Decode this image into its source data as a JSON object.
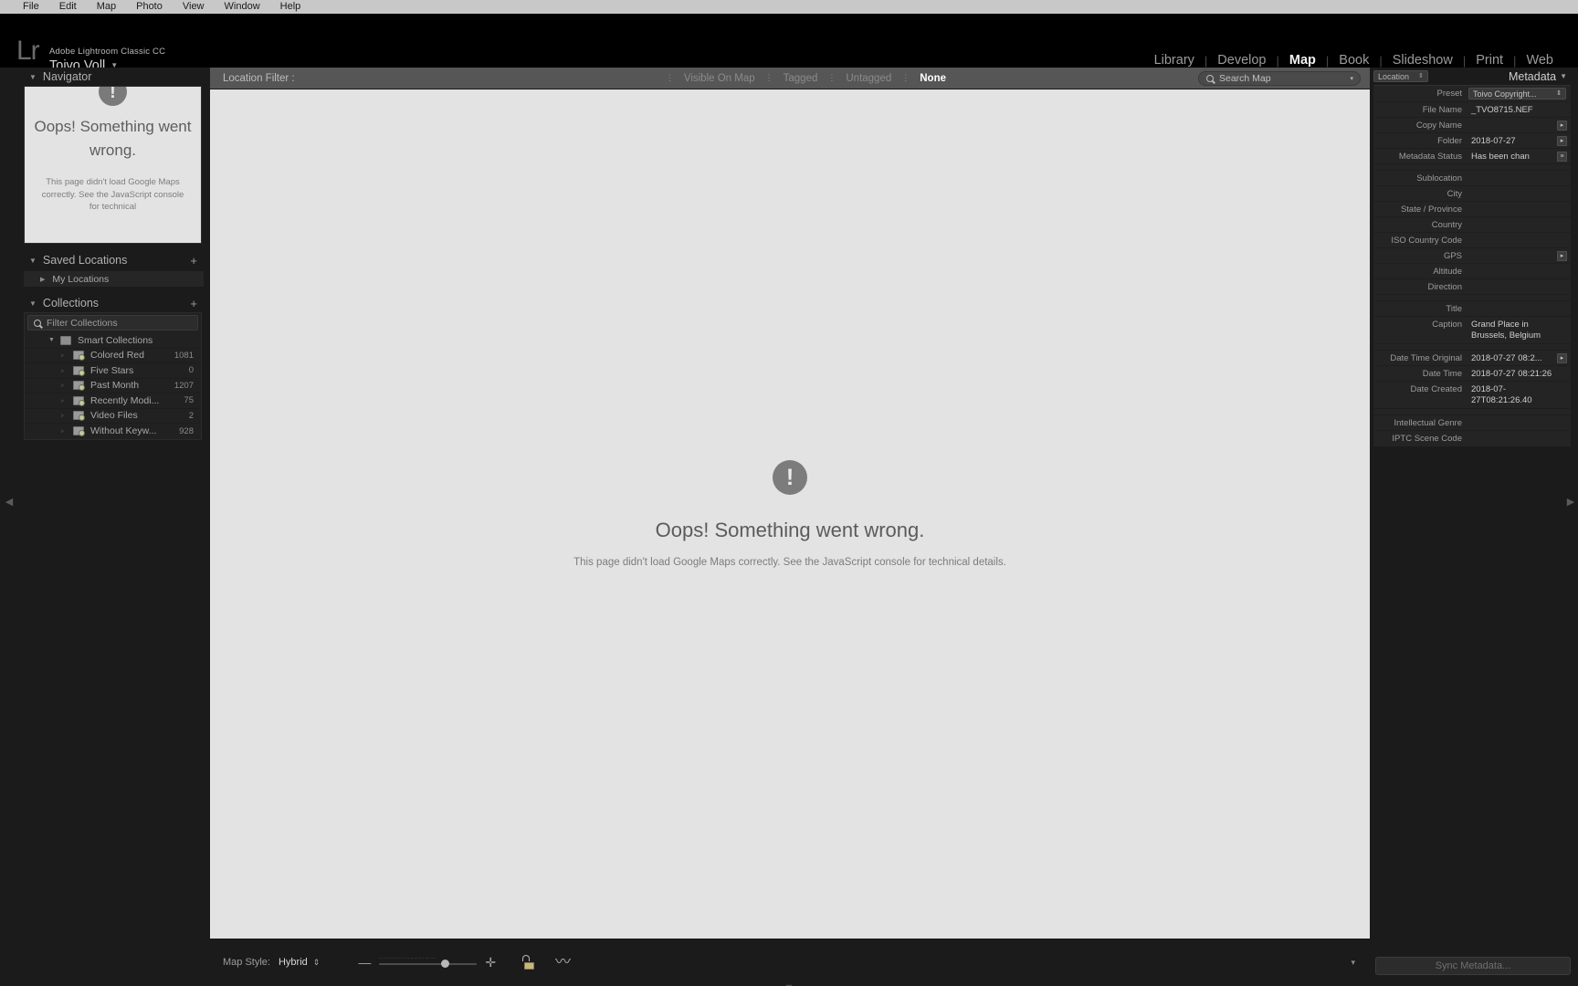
{
  "menubar": {
    "items": [
      "File",
      "Edit",
      "Map",
      "Photo",
      "View",
      "Window",
      "Help"
    ]
  },
  "identity": {
    "logo": "Lr",
    "app_name": "Adobe Lightroom Classic CC",
    "user_name": "Toivo Voll",
    "caret": "▼"
  },
  "modules": {
    "items": [
      {
        "label": "Library",
        "active": false
      },
      {
        "label": "Develop",
        "active": false
      },
      {
        "label": "Map",
        "active": true
      },
      {
        "label": "Book",
        "active": false
      },
      {
        "label": "Slideshow",
        "active": false
      },
      {
        "label": "Print",
        "active": false
      },
      {
        "label": "Web",
        "active": false
      }
    ],
    "separator": "|"
  },
  "left_panel": {
    "navigator": {
      "title": "Navigator",
      "triangle": "▼",
      "error_badge": "!",
      "error_title": "Oops! Something went wrong.",
      "error_detail": "This page didn't load Google Maps correctly. See the JavaScript console for technical"
    },
    "saved_locations": {
      "title": "Saved Locations",
      "triangle": "▼",
      "add_label": "+",
      "items": [
        {
          "label": "My Locations",
          "triangle": "▶"
        }
      ]
    },
    "collections": {
      "title": "Collections",
      "triangle": "▼",
      "add_label": "+",
      "filter_placeholder": "Filter Collections",
      "group": {
        "label": "Smart Collections",
        "triangle": "▼"
      },
      "items": [
        {
          "label": "Colored Red",
          "count": "1081"
        },
        {
          "label": "Five Stars",
          "count": "0"
        },
        {
          "label": "Past Month",
          "count": "1207"
        },
        {
          "label": "Recently Modi...",
          "count": "75"
        },
        {
          "label": "Video Files",
          "count": "2"
        },
        {
          "label": "Without Keyw...",
          "count": "928"
        }
      ]
    }
  },
  "filter_bar": {
    "label": "Location Filter :",
    "buttons": [
      {
        "label": "Visible On Map",
        "active": false
      },
      {
        "label": "Tagged",
        "active": false
      },
      {
        "label": "Untagged",
        "active": false
      },
      {
        "label": "None",
        "active": true
      }
    ],
    "search_placeholder": "Search Map",
    "search_caret": "▾"
  },
  "map": {
    "error_badge": "!",
    "error_title": "Oops! Something went wrong.",
    "error_detail": "This page didn't load Google Maps correctly. See the JavaScript console for technical details."
  },
  "toolbar": {
    "map_style_label": "Map Style:",
    "map_style_value": "Hybrid",
    "stepper": "⇕",
    "zoom_minus": "—",
    "zoom_plus": "✛",
    "collapse_caret": "▾"
  },
  "right_panel": {
    "location_tab": "Location",
    "location_stepper": "⇕",
    "title": "Metadata",
    "title_triangle": "▼",
    "preset_label": "Preset",
    "preset_value": "Toivo Copyright...",
    "fields": [
      {
        "label": "File Name",
        "value": "_TVO8715.NEF",
        "button": ""
      },
      {
        "label": "Copy Name",
        "value": "",
        "button": "▸"
      },
      {
        "label": "Folder",
        "value": "2018-07-27",
        "button": "▸"
      },
      {
        "label": "Metadata Status",
        "value": "Has been chan",
        "button": "≡"
      },
      {
        "label": "Sublocation",
        "value": "",
        "button": ""
      },
      {
        "label": "City",
        "value": "",
        "button": ""
      },
      {
        "label": "State / Province",
        "value": "",
        "button": ""
      },
      {
        "label": "Country",
        "value": "",
        "button": ""
      },
      {
        "label": "ISO Country Code",
        "value": "",
        "button": ""
      },
      {
        "label": "GPS",
        "value": "",
        "button": "▸"
      },
      {
        "label": "Altitude",
        "value": "",
        "button": ""
      },
      {
        "label": "Direction",
        "value": "",
        "button": ""
      },
      {
        "label": "Title",
        "value": "",
        "button": ""
      },
      {
        "label": "Caption",
        "value": "Grand Place in Brussels, Belgium",
        "button": "",
        "wrap": true
      },
      {
        "label": "Date Time Original",
        "value": "2018-07-27 08:2...",
        "button": "▸"
      },
      {
        "label": "Date Time",
        "value": "2018-07-27 08:21:26",
        "button": ""
      },
      {
        "label": "Date Created",
        "value": "2018-07-27T08:21:26.40",
        "button": "",
        "wrap": true
      },
      {
        "label": "Intellectual Genre",
        "value": "",
        "button": ""
      },
      {
        "label": "IPTC Scene Code",
        "value": "",
        "button": ""
      }
    ],
    "sync_button": "Sync Metadata..."
  },
  "colors": {
    "panel_bg": "#1b1b1b",
    "map_bg": "#e3e3e3",
    "filter_bar": "#565656",
    "active_text": "#ffffff"
  }
}
